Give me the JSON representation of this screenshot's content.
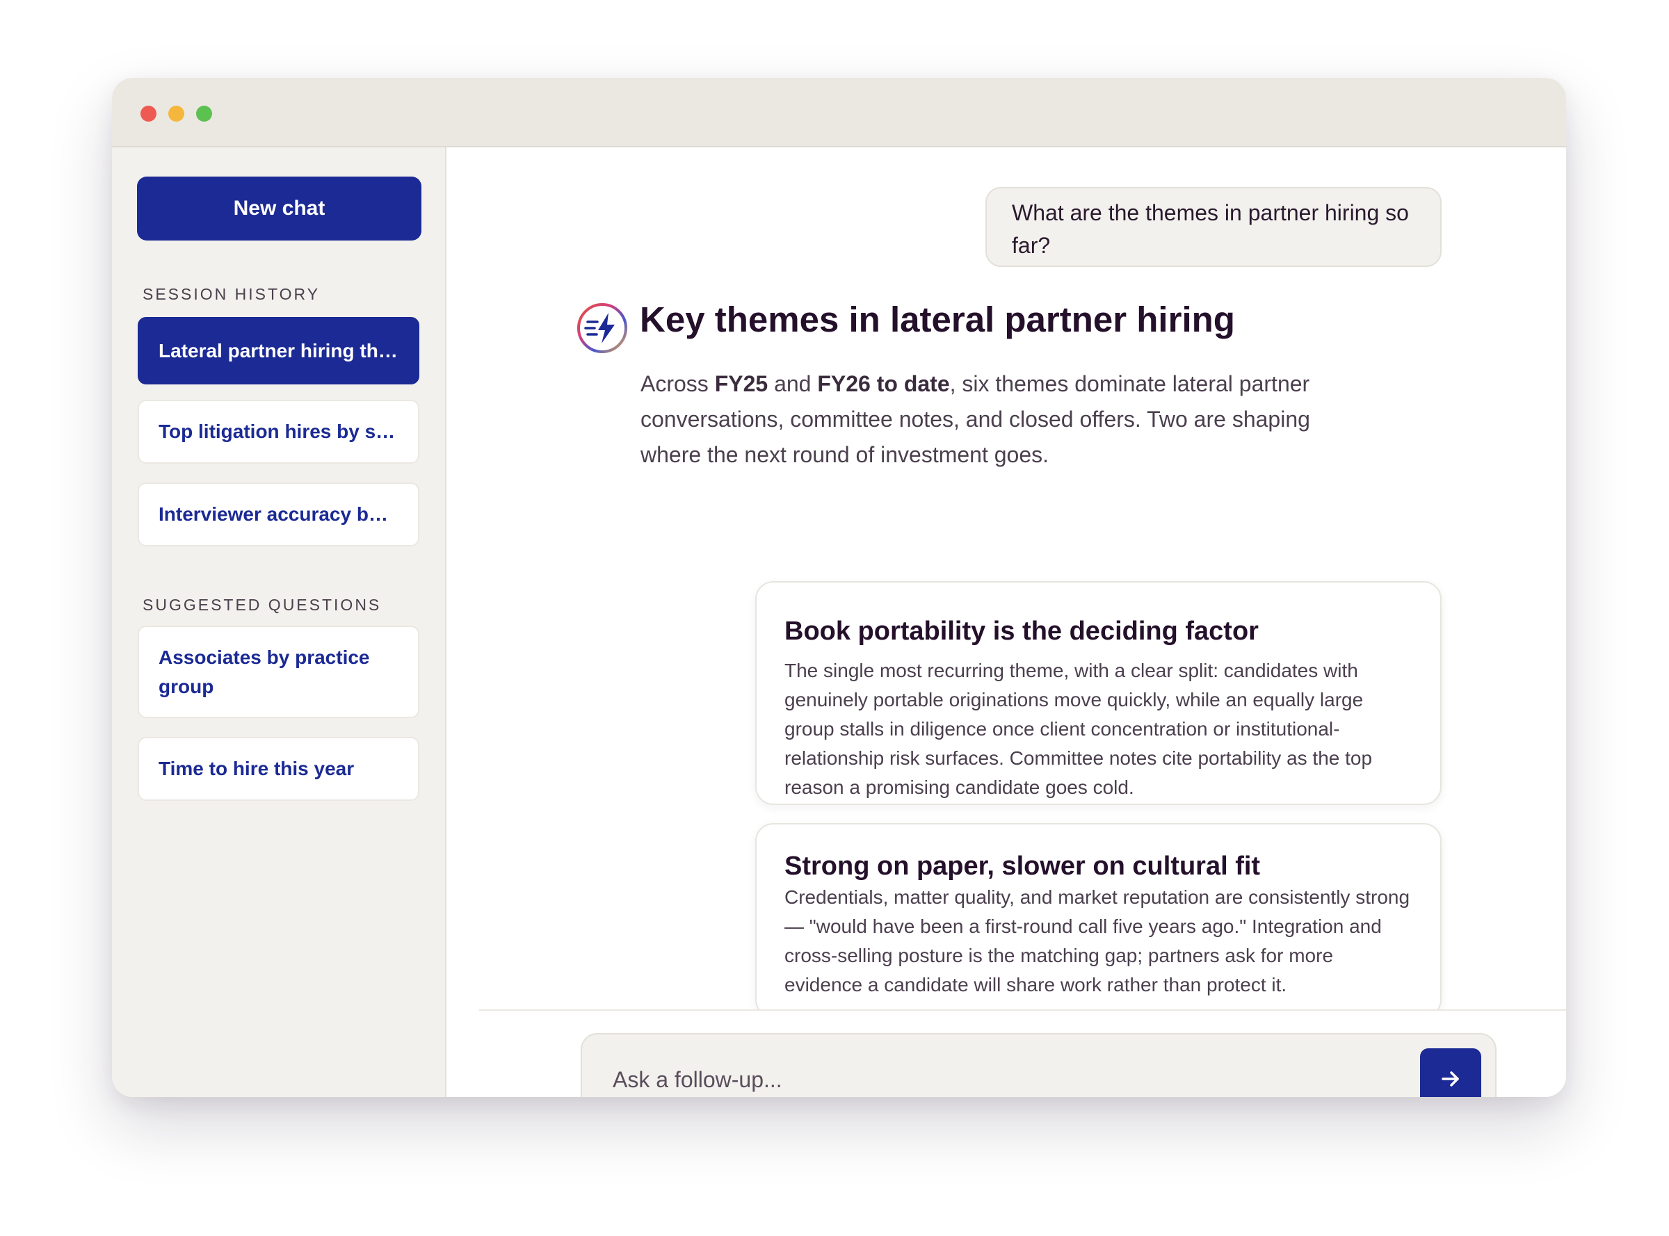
{
  "window": {
    "controls": [
      "close",
      "minimize",
      "zoom"
    ],
    "control_colors": {
      "close": "#ee5a52",
      "minimize": "#f5b73b",
      "zoom": "#5cc150"
    }
  },
  "sidebar": {
    "new_chat_label": "New chat",
    "session_history_label": "SESSION HISTORY",
    "history": [
      {
        "label": "Lateral partner hiring themes",
        "active": true
      },
      {
        "label": "Top litigation hires by source",
        "active": false
      },
      {
        "label": "Interviewer accuracy by stage",
        "active": false
      }
    ],
    "suggested_label": "SUGGESTED QUESTIONS",
    "suggested": [
      {
        "label": "Associates by practice group"
      },
      {
        "label": "Time to hire this year"
      }
    ]
  },
  "conversation": {
    "user_message": "What are the themes in partner hiring so far?",
    "answer": {
      "icon": "bolt-list-icon",
      "title": "Key themes in lateral partner hiring",
      "lead_prefix": "Across ",
      "lead_bold_1": "FY25",
      "lead_mid": " and ",
      "lead_bold_2": "FY26 to date",
      "lead_suffix": ", six themes dominate lateral partner conversations, committee notes, and closed offers. Two are shaping where the next round of investment goes.",
      "themes": [
        {
          "title": "Book portability is the deciding factor",
          "body": "The single most recurring theme, with a clear split: candidates with genuinely portable originations move quickly, while an equally large group stalls in diligence once client concentration or institutional-relationship risk surfaces. Committee notes cite portability as the top reason a promising candidate goes cold."
        },
        {
          "title": "Strong on paper, slower on cultural fit",
          "body": "Credentials, matter quality, and market reputation are consistently strong — \"would have been a first-round call five years ago.\" Integration and cross-selling posture is the matching gap; partners ask for more evidence a candidate will share work rather than protect it."
        }
      ]
    }
  },
  "composer": {
    "placeholder": "Ask a follow-up...",
    "send_icon": "arrow-right-icon"
  },
  "colors": {
    "accent": "#1b2a94",
    "sidebar_bg": "#f3f1ed",
    "titlebar_bg": "#ebe8e2"
  }
}
